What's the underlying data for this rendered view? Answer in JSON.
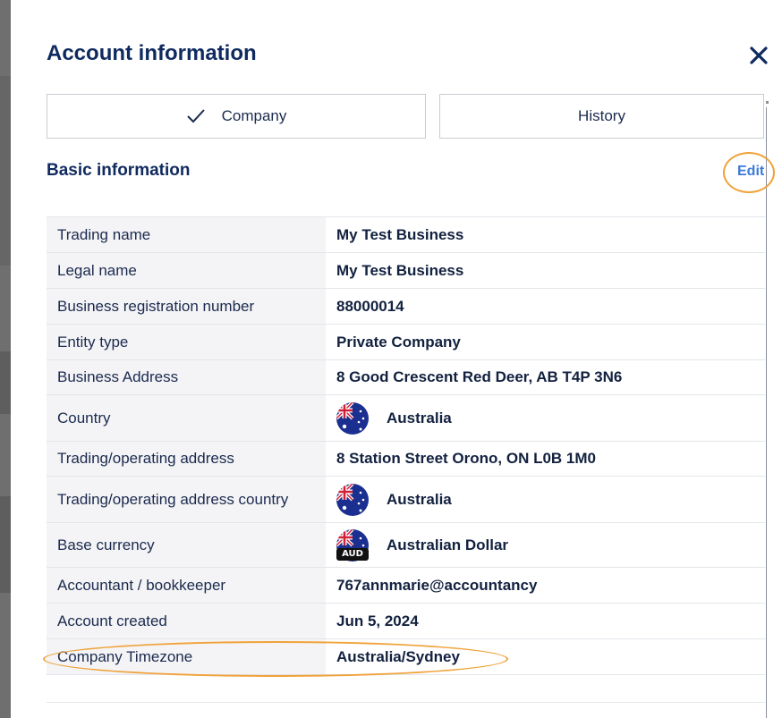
{
  "modal": {
    "title": "Account information",
    "close_icon": "close-icon"
  },
  "tabs": [
    {
      "label": "Company",
      "active": true,
      "icon": "checkmark-icon"
    },
    {
      "label": "History",
      "active": false
    }
  ],
  "section": {
    "title": "Basic information",
    "edit_label": "Edit"
  },
  "rows": [
    {
      "label": "Trading name",
      "value": "My Test Business"
    },
    {
      "label": "Legal name",
      "value": "My Test Business"
    },
    {
      "label": "Business registration number",
      "value": "88000014"
    },
    {
      "label": "Entity type",
      "value": "Private Company"
    },
    {
      "label": "Business Address",
      "value": "8 Good Crescent Red Deer, AB T4P 3N6"
    },
    {
      "label": "Country",
      "value": "Australia",
      "icon": "australia-flag-icon"
    },
    {
      "label": "Trading/operating address",
      "value": "8 Station Street Orono, ON L0B 1M0"
    },
    {
      "label": "Trading/operating address country",
      "value": "Australia",
      "icon": "australia-flag-icon"
    },
    {
      "label": "Base currency",
      "value": "Australian Dollar",
      "icon": "australia-flag-icon",
      "badge": "AUD"
    },
    {
      "label": "Accountant / bookkeeper",
      "value": "767annmarie@accountancy"
    },
    {
      "label": "Account created",
      "value": "Jun 5, 2024"
    },
    {
      "label": "Company Timezone",
      "value": "Australia/Sydney"
    }
  ],
  "colors": {
    "accent": "#3b7bd8",
    "highlight_ring": "#f0a23a",
    "title": "#0f2a5f"
  }
}
